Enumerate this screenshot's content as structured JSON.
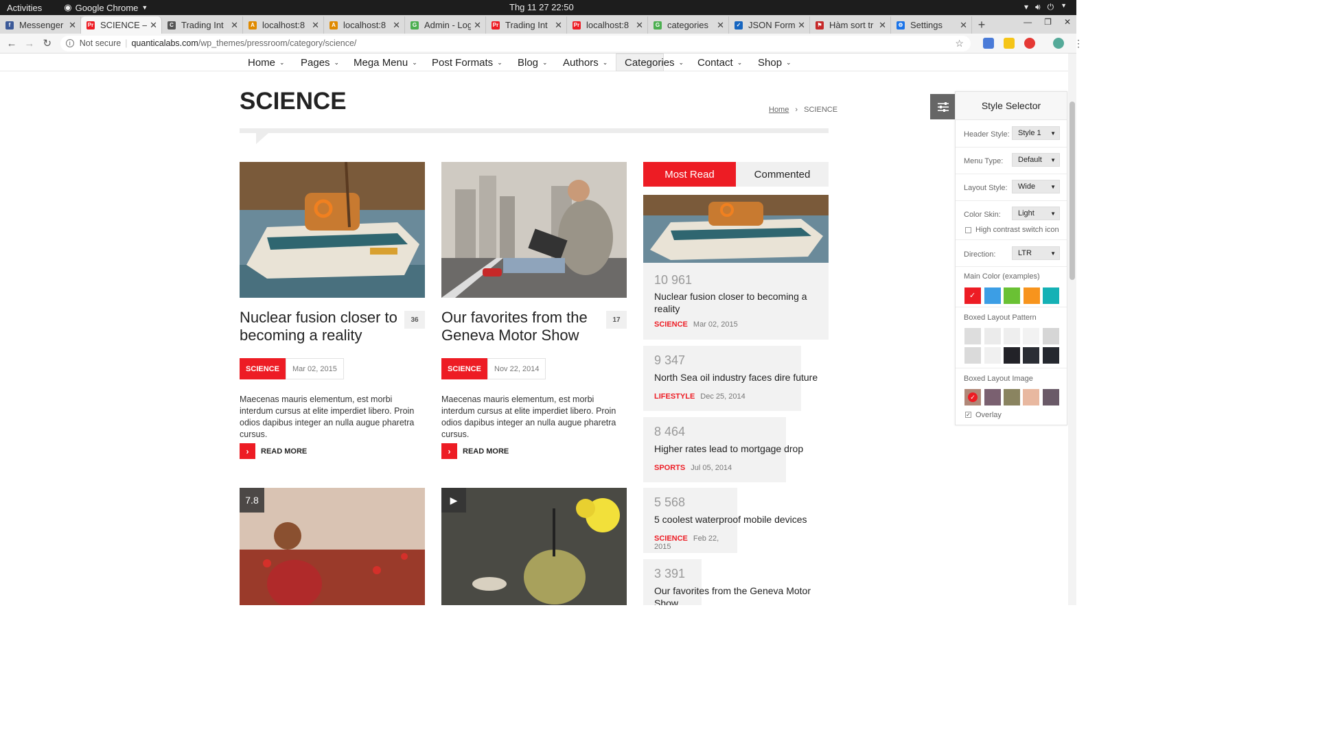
{
  "os": {
    "activities": "Activities",
    "app": "Google Chrome",
    "clock": "Thg 11 27  22:50"
  },
  "tabs": [
    {
      "label": "Messenger",
      "color": "#3b5998",
      "glyph": "f"
    },
    {
      "label": "SCIENCE – P",
      "color": "#ed1c24",
      "glyph": "Pr"
    },
    {
      "label": "Trading Int",
      "color": "#555",
      "glyph": "C"
    },
    {
      "label": "localhost:8",
      "color": "#e08a00",
      "glyph": "A"
    },
    {
      "label": "localhost:8",
      "color": "#e08a00",
      "glyph": "A"
    },
    {
      "label": "Admin - Log",
      "color": "#4caf50",
      "glyph": "G"
    },
    {
      "label": "Trading Int",
      "color": "#ed1c24",
      "glyph": "Pr"
    },
    {
      "label": "localhost:8",
      "color": "#ed1c24",
      "glyph": "Pr"
    },
    {
      "label": "categories",
      "color": "#4caf50",
      "glyph": "G"
    },
    {
      "label": "JSON Form",
      "color": "#1565c0",
      "glyph": "✓"
    },
    {
      "label": "Hàm sort tr",
      "color": "#c62828",
      "glyph": "⚑"
    },
    {
      "label": "Settings",
      "color": "#1a73e8",
      "glyph": "⚙"
    }
  ],
  "address": {
    "security": "Not secure",
    "host": "quanticalabs.com",
    "path": "/wp_themes/pressroom/category/science/"
  },
  "menu": [
    {
      "label": "Home"
    },
    {
      "label": "Pages"
    },
    {
      "label": "Mega Menu"
    },
    {
      "label": "Post Formats"
    },
    {
      "label": "Blog"
    },
    {
      "label": "Authors"
    },
    {
      "label": "Categories"
    },
    {
      "label": "Contact"
    },
    {
      "label": "Shop"
    }
  ],
  "page_title": "SCIENCE",
  "breadcrumb": {
    "home": "Home",
    "sep": "›",
    "current": "SCIENCE"
  },
  "posts": [
    {
      "title": "Nuclear fusion closer to becoming a reality",
      "comments": "36",
      "category": "SCIENCE",
      "date": "Mar 02, 2015",
      "excerpt": "Maecenas mauris elementum, est morbi interdum cursus at elite imperdiet libero. Proin odios dapibus integer an nulla augue pharetra cursus.",
      "read_more": "READ MORE"
    },
    {
      "title": "Our favorites from the Geneva Motor Show",
      "comments": "17",
      "category": "SCIENCE",
      "date": "Nov 22, 2014",
      "excerpt": "Maecenas mauris elementum, est morbi interdum cursus at elite imperdiet libero. Proin odios dapibus integer an nulla augue pharetra cursus.",
      "read_more": "READ MORE"
    }
  ],
  "lower_posts": [
    {
      "badge": "7.8"
    },
    {
      "badge": "▶"
    }
  ],
  "sidebar": {
    "tabs": [
      "Most Read",
      "Commented"
    ],
    "items": [
      {
        "count": "10 961",
        "title": "Nuclear fusion closer to becoming a reality",
        "category": "SCIENCE",
        "date": "Mar 02, 2015"
      },
      {
        "count": "9 347",
        "title": "North Sea oil industry faces dire future",
        "category": "LIFESTYLE",
        "date": "Dec 25, 2014"
      },
      {
        "count": "8 464",
        "title": "Higher rates lead to mortgage drop",
        "category": "SPORTS",
        "date": "Jul 05, 2014"
      },
      {
        "count": "5 568",
        "title": "5 coolest waterproof mobile devices",
        "category": "SCIENCE",
        "date": "Feb 22, 2015"
      },
      {
        "count": "3 391",
        "title": "Our favorites from the Geneva Motor Show",
        "category": "",
        "date": ""
      }
    ]
  },
  "style_selector": {
    "title": "Style Selector",
    "header_style": {
      "label": "Header Style:",
      "value": "Style 1"
    },
    "menu_type": {
      "label": "Menu Type:",
      "value": "Default"
    },
    "layout_style": {
      "label": "Layout Style:",
      "value": "Wide"
    },
    "color_skin": {
      "label": "Color Skin:",
      "value": "Light"
    },
    "high_contrast": "High contrast switch icon",
    "direction": {
      "label": "Direction:",
      "value": "LTR"
    },
    "main_color_label": "Main Color (examples)",
    "main_colors": [
      "#ed1c24",
      "#3c9ee5",
      "#6ac134",
      "#f7941d",
      "#15b1b5"
    ],
    "pattern_label": "Boxed Layout Pattern",
    "image_label": "Boxed Layout Image",
    "overlay": "Overlay"
  },
  "colors": {
    "accent": "#ed1c24"
  }
}
